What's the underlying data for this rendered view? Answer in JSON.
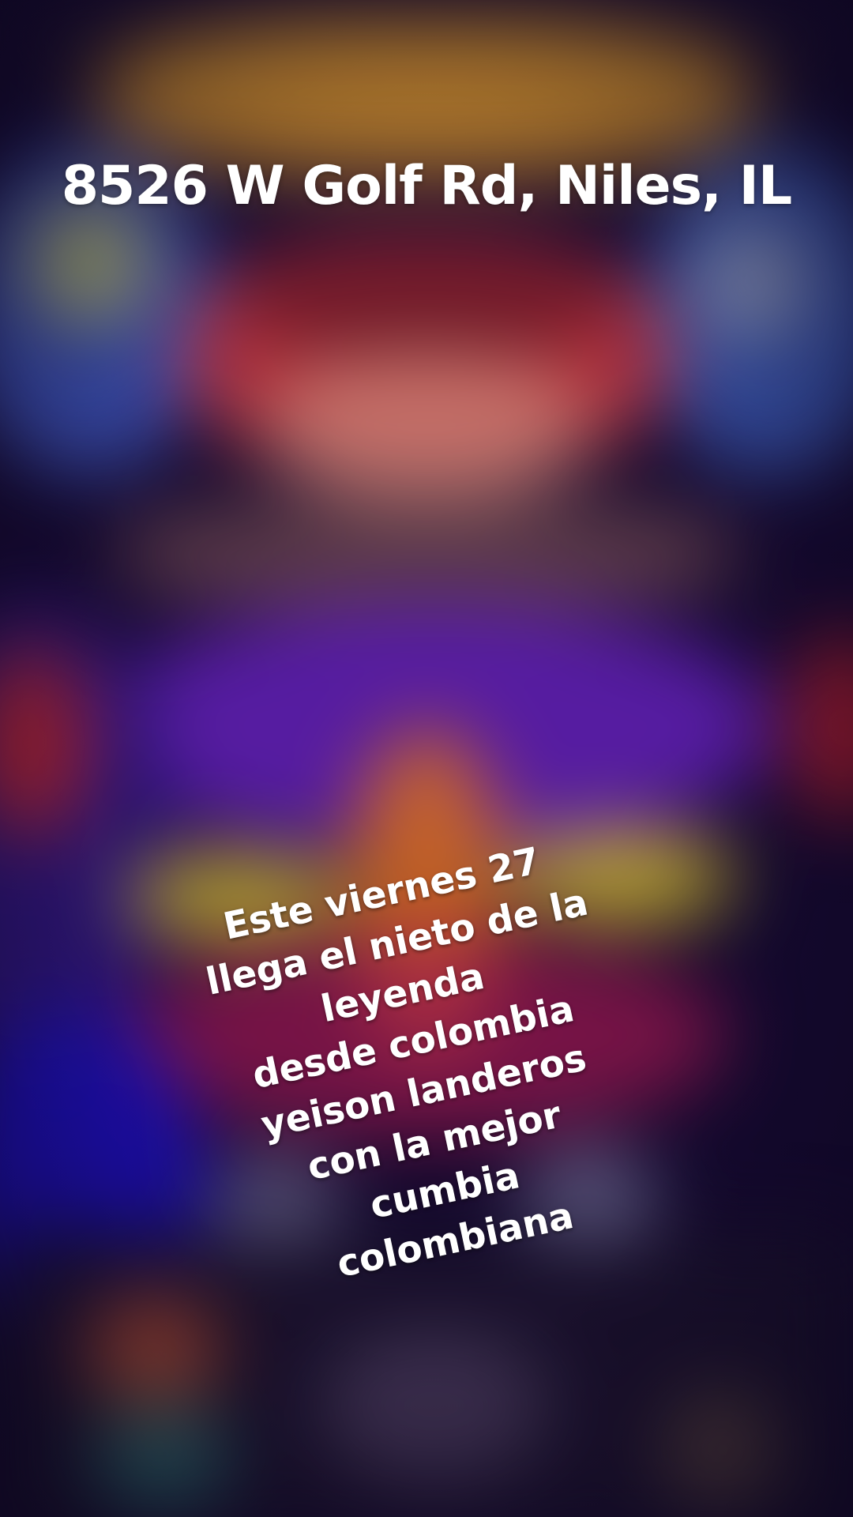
{
  "address": "8526 W Golf Rd, Niles, IL",
  "caption": {
    "lines": [
      "Este viernes 27",
      "llega el nieto de la",
      "leyenda",
      "desde colombia",
      "yeison landeros",
      "con la mejor",
      "cumbia",
      "colombiana"
    ]
  }
}
